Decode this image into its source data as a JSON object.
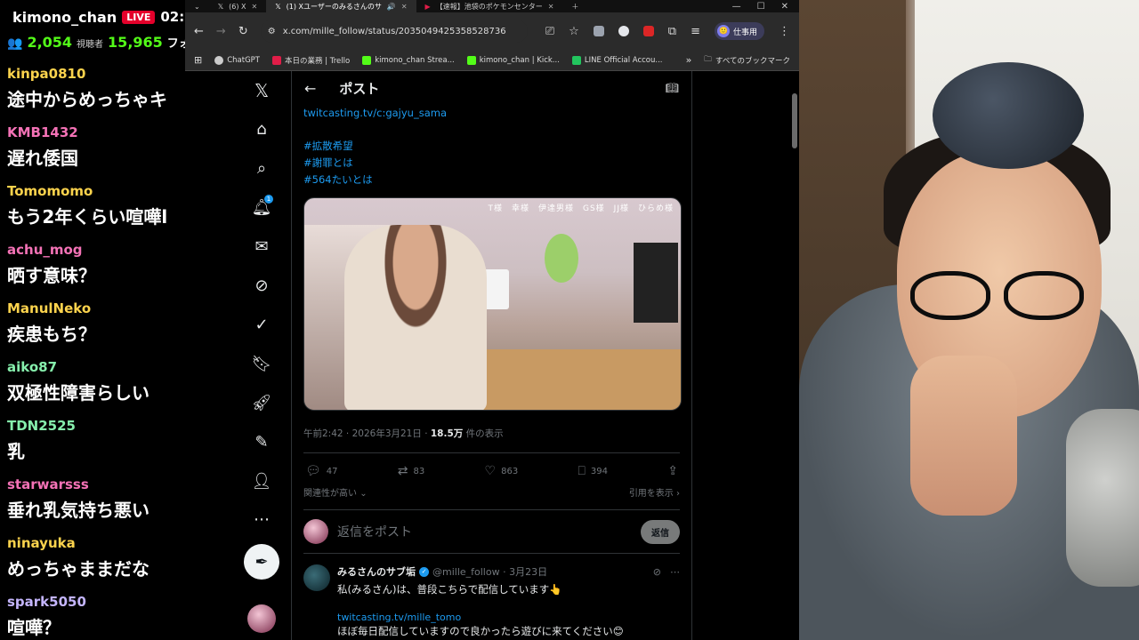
{
  "chat": {
    "channel": "kimono_chan",
    "live_label": "LIVE",
    "time": "02:",
    "viewers": "2,054",
    "viewers_label": "視聴者",
    "followers": "15,965",
    "followers_label": "フォロ",
    "messages": [
      {
        "user": "kinpa0810",
        "color": "#fcd34d",
        "text": "途中からめっちゃキ"
      },
      {
        "user": "KMB1432",
        "color": "#f472b6",
        "text": "遅れ倭国"
      },
      {
        "user": "Tomomomo",
        "color": "#fcd34d",
        "text": "もう2年くらい喧嘩l"
      },
      {
        "user": "achu_mog",
        "color": "#f472b6",
        "text": "晒す意味？"
      },
      {
        "user": "ManulNeko",
        "color": "#fcd34d",
        "text": "疾患もち？"
      },
      {
        "user": "aiko87",
        "color": "#86efac",
        "text": "双極性障害らしい"
      },
      {
        "user": "TDN2525",
        "color": "#86efac",
        "text": "乳"
      },
      {
        "user": "starwarsss",
        "color": "#f472b6",
        "text": "垂れ乳気持ち悪い"
      },
      {
        "user": "ninayuka",
        "color": "#fcd34d",
        "text": "めっちゃままだな"
      },
      {
        "user": "spark5050",
        "color": "#c4b5fd",
        "text": "喧嘩？"
      }
    ]
  },
  "browser": {
    "tabs": [
      {
        "label": "(6) X",
        "active": false
      },
      {
        "label": "(1) Xユーザーのみるさんのサ",
        "active": true
      },
      {
        "label": "【速報】池袋のポケモンセンター",
        "active": false
      }
    ],
    "url": "x.com/mille_follow/status/2035049425358528736",
    "profile_label": "仕事用",
    "bookmarks": [
      {
        "label": "ChatGPT",
        "color": "#cccccc"
      },
      {
        "label": "本日の業務 | Trello",
        "color": "#e11d48"
      },
      {
        "label": "kimono_chan Strea...",
        "color": "#53fc18"
      },
      {
        "label": "kimono_chan | Kick...",
        "color": "#53fc18"
      },
      {
        "label": "LINE Official Accou...",
        "color": "#22c55e"
      }
    ],
    "bookmarks_folder": "すべてのブックマーク"
  },
  "x": {
    "header_title": "ポスト",
    "links": {
      "twitcasting": "twitcasting.tv/c:gajyu_sama",
      "hashtag1": "#拡散希望",
      "hashtag2": "#謝罪とは",
      "hashtag3": "#564たいとは"
    },
    "media_names": "T様　幸様　伊達男様　GS様　JJ様　ひらめ様",
    "meta": {
      "time": "午前2:42 · 2026年3月21日 · ",
      "views": "18.5万",
      "views_label": " 件の表示"
    },
    "actions": {
      "replies": "47",
      "reposts": "83",
      "likes": "863",
      "bookmarks": "394"
    },
    "sort_label": "関連性が高い",
    "quote_label": "引用を表示",
    "reply_placeholder": "返信をポスト",
    "reply_button": "返信",
    "reply_tweet": {
      "name": "みるさんのサブ垢",
      "handle": "@mille_follow · 3月23日",
      "text": "私(みるさん)は、普段こちらで配信しています👆",
      "link": "twitcasting.tv/mille_tomo",
      "text2": "ほぼ毎日配信していますので良かったら遊びに来てください😊"
    },
    "notification_count": "1"
  },
  "colors": {
    "accent": "#1d9bf0",
    "kick_green": "#53fc18",
    "live_red": "#e4002b"
  }
}
